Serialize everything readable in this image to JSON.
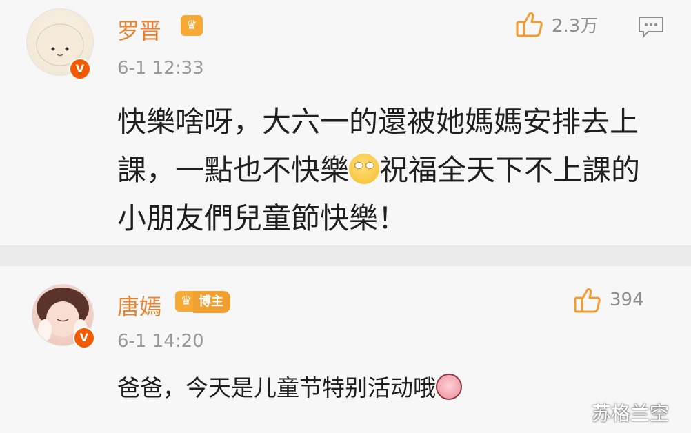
{
  "comments": [
    {
      "username": "罗晋",
      "time": "6-1 12:33",
      "likes": "2.3万",
      "body_parts": [
        "快樂啥呀，大六一的還被她媽媽安排去上課，一點也不快樂",
        "祝福全天下不上課的小朋友們兒童節快樂！"
      ],
      "emoji": "eye-roll-emoji"
    },
    {
      "username": "唐嫣",
      "badge_text": "博主",
      "time": "6-1 14:20",
      "likes": "394",
      "body_parts": [
        "爸爸，今天是儿童节特别活动哦"
      ],
      "emoji": "pig-face-emoji"
    }
  ],
  "watermark": "苏格兰空",
  "colors": {
    "username": "#e7822f",
    "verified": "#f35b00",
    "text": "#1f1f1f",
    "meta": "#9a9a9a"
  }
}
